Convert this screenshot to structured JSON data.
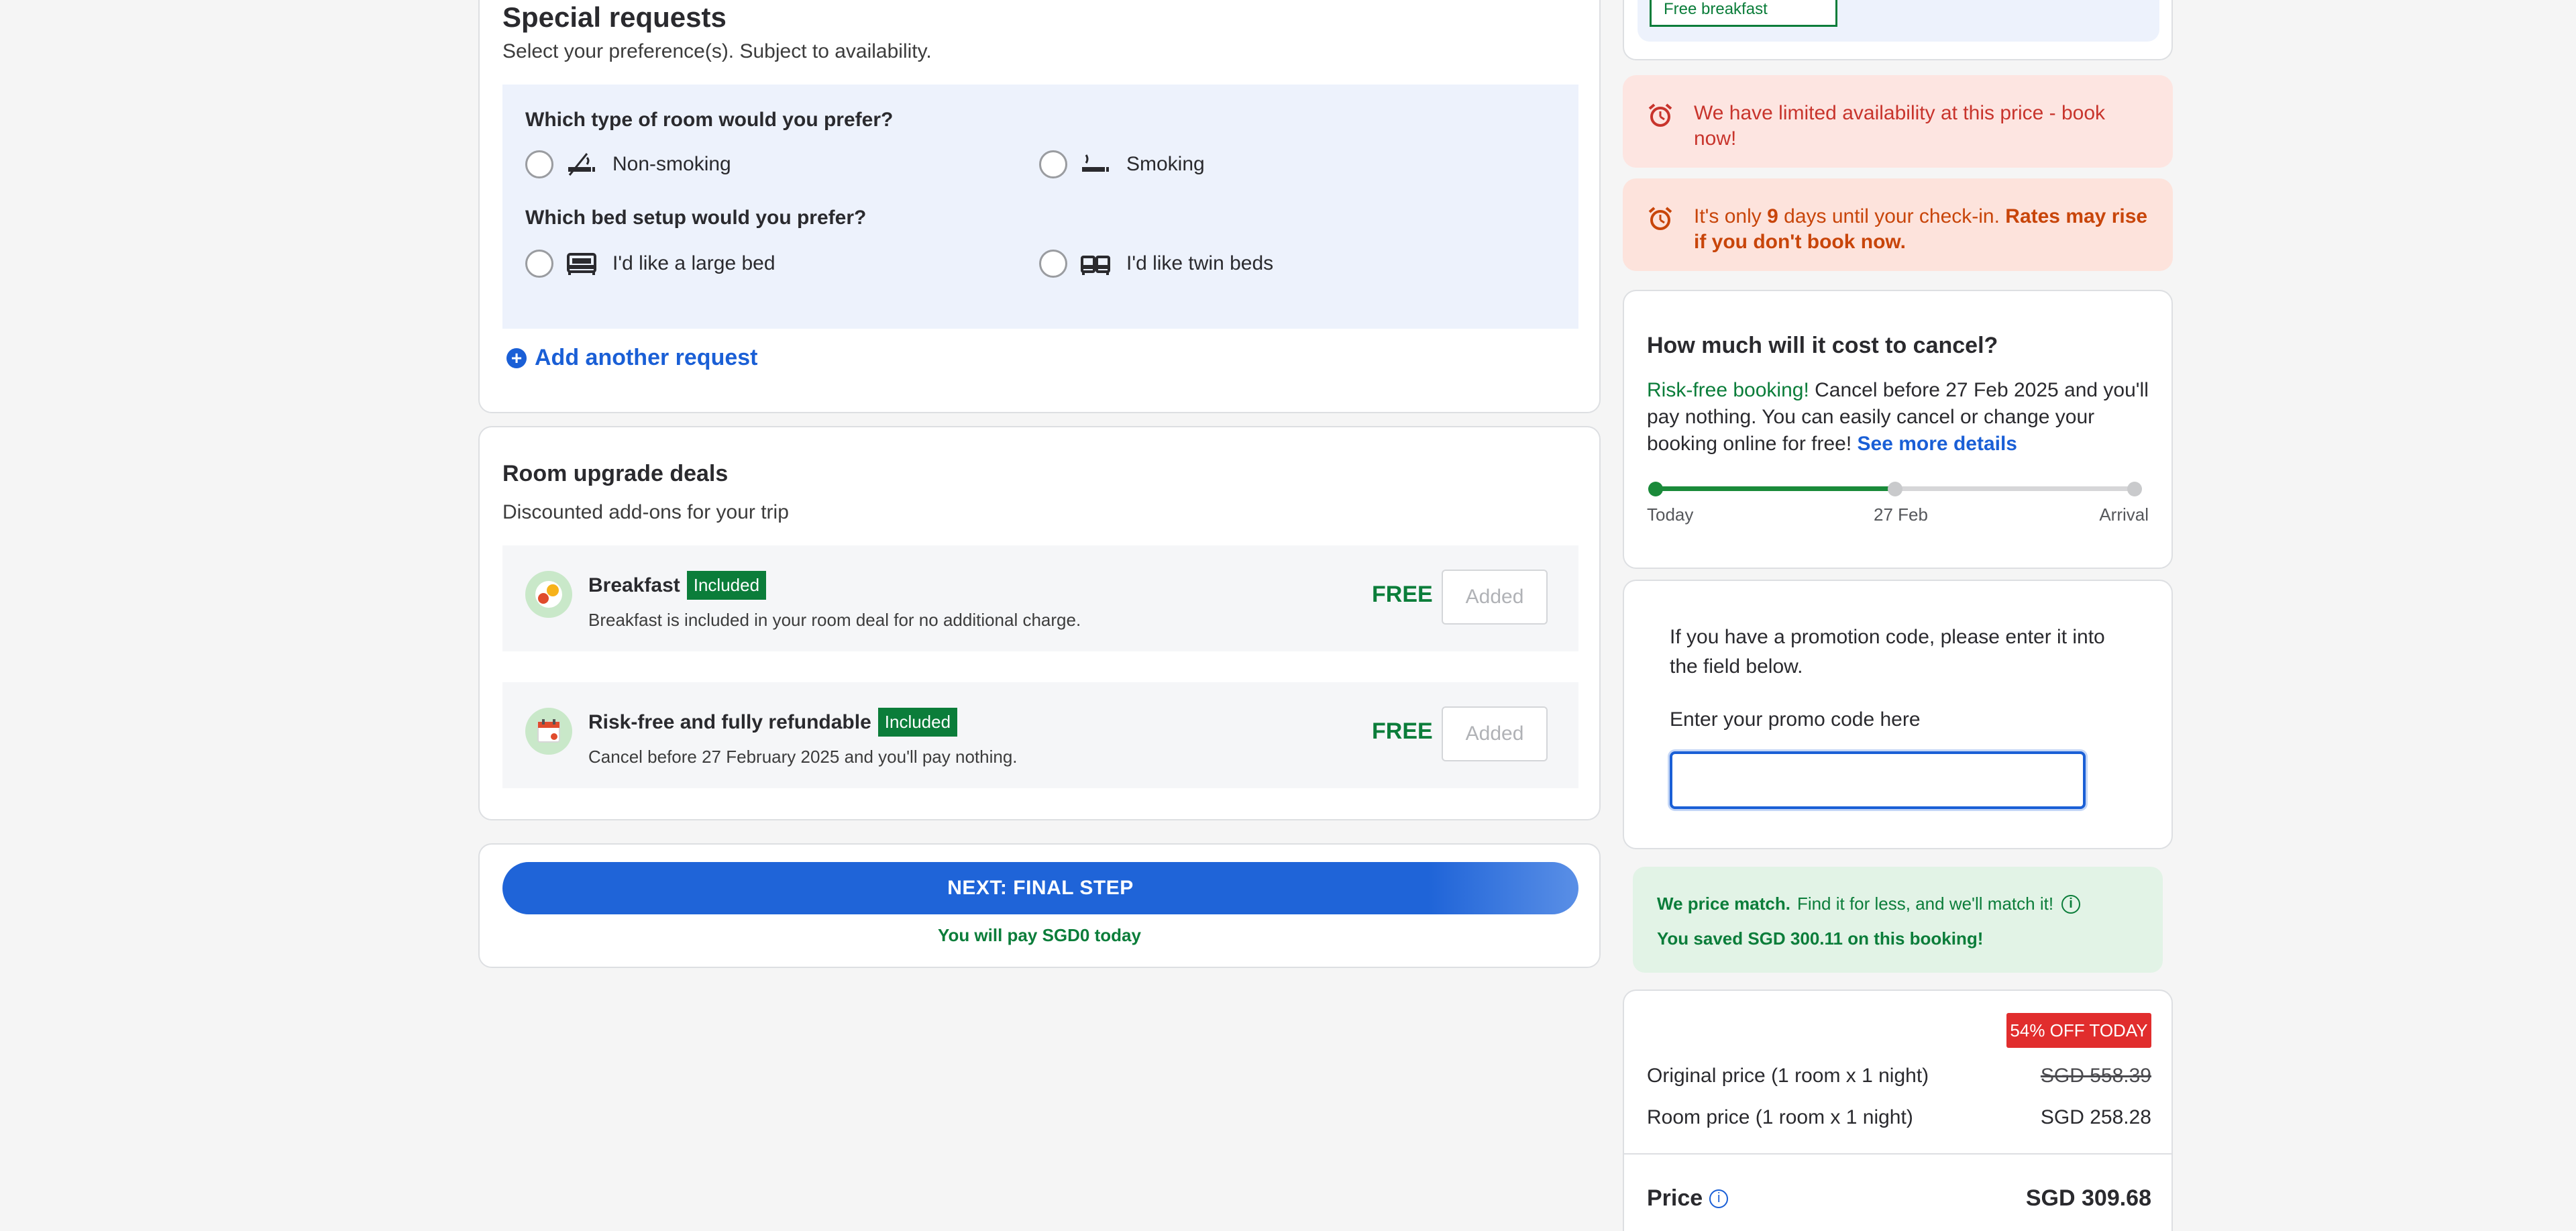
{
  "special_requests": {
    "title": "Special requests",
    "subtitle": "Select your preference(s). Subject to availability.",
    "room_question": "Which type of room would you prefer?",
    "room_options": [
      "Non-smoking",
      "Smoking"
    ],
    "bed_question": "Which bed setup would you prefer?",
    "bed_options": [
      "I'd like a large bed",
      "I'd like twin beds"
    ],
    "add_request": "Add another request"
  },
  "upgrades": {
    "title": "Room upgrade deals",
    "subtitle": "Discounted add-ons for your trip",
    "deals": [
      {
        "name": "Breakfast",
        "badge": "Included",
        "desc": "Breakfast is included in your room deal for no additional charge.",
        "price": "FREE",
        "button": "Added",
        "icon": "breakfast-icon"
      },
      {
        "name": "Risk-free and fully refundable",
        "badge": "Included",
        "desc": "Cancel before 27 February 2025 and you'll pay nothing.",
        "price": "FREE",
        "button": "Added",
        "icon": "calendar-icon"
      }
    ]
  },
  "next": {
    "button": "NEXT: FINAL STEP",
    "pay_note": "You will pay SGD0 today"
  },
  "sidebar": {
    "free_breakfast_chip": "Free breakfast",
    "alert_limited": "We have limited availability at this price - book now!",
    "alert_days_prefix": "It's only ",
    "alert_days_count": "9",
    "alert_days_mid": " days until your check-in. ",
    "alert_days_bold": "Rates may rise if you don't book now.",
    "cancel": {
      "title": "How much will it cost to cancel?",
      "green": "Risk-free booking!",
      "text": " Cancel before 27 Feb 2025 and you'll pay nothing. You can easily cancel or change your booking online for free! ",
      "link": "See more details",
      "timeline_labels": [
        "Today",
        "27 Feb",
        "Arrival"
      ],
      "progress_fraction": 0.5
    },
    "promo": {
      "text": "If you have a promotion code, please enter it into the field below.",
      "label": "Enter your promo code here",
      "value": ""
    },
    "match": {
      "bold": "We price match.",
      "text": "Find it for less, and we'll match it!",
      "saved": "You saved SGD 300.11 on this booking!"
    },
    "price": {
      "badge": "54% OFF TODAY",
      "original_label": "Original price (1 room x 1 night)",
      "original_value": "SGD 558.39",
      "room_label": "Room price (1 room x 1 night)",
      "room_value": "SGD 258.28",
      "total_label": "Price",
      "total_value": "SGD 309.68"
    }
  },
  "colors": {
    "accent_blue": "#1a5fd6",
    "success_green": "#0b7d3a",
    "alert_red": "#c8342c",
    "alert_orange": "#c8450a",
    "badge_red": "#e12d2d"
  }
}
